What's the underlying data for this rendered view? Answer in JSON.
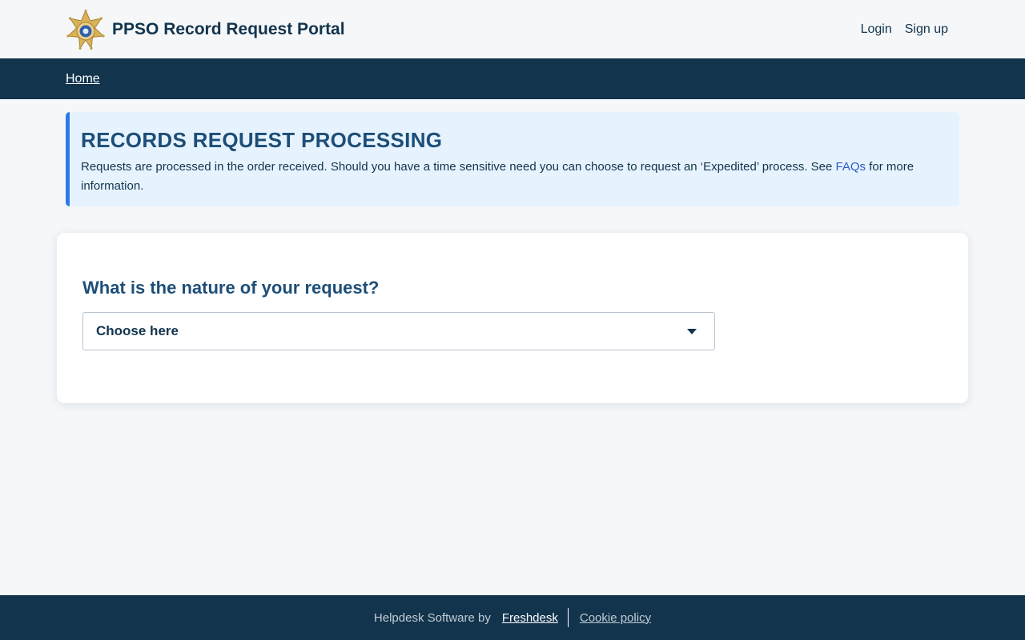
{
  "header": {
    "portal_title": "PPSO Record Request Portal",
    "login_label": "Login",
    "signup_label": "Sign up",
    "logo_icon": "sheriff-star-badge-icon"
  },
  "breadcrumb": {
    "home_label": "Home"
  },
  "notice": {
    "title": "RECORDS REQUEST PROCESSING",
    "text_before_link": "Requests are processed in the order received. Should you have a time sensitive need you can choose to request an ‘Expedited’ process. See ",
    "link_label": "FAQs",
    "text_after_link": " for more information."
  },
  "form": {
    "question": "What is the nature of your request?",
    "select_value": "Choose here"
  },
  "footer": {
    "helpdesk_text": "Helpdesk Software by",
    "freshdesk_label": "Freshdesk",
    "cookie_label": "Cookie policy"
  },
  "colors": {
    "navy": "#12344d",
    "banner_bg": "#e6f3fe",
    "banner_accent": "#2c7be5",
    "link_blue": "#2c5cc5"
  }
}
